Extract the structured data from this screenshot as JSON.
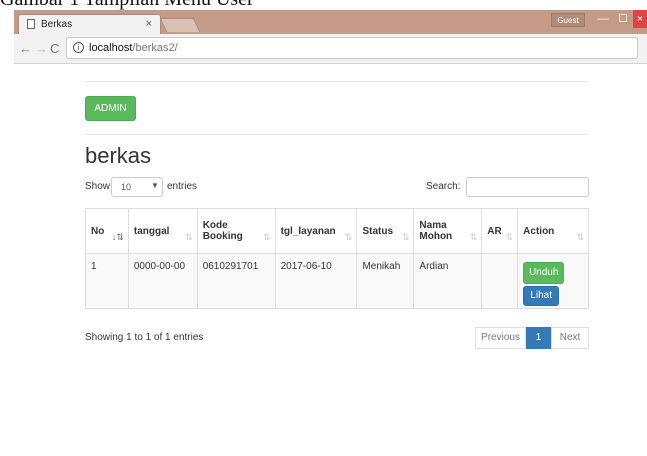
{
  "caption": "Gambar 1 Tampilan Menu User",
  "browser": {
    "tab_title": "Berkas",
    "tab_close": "×",
    "guest_label": "Guest",
    "url_host": "localhost",
    "url_path": "/berkas2/",
    "win_min": "—",
    "win_max": "☐",
    "win_close": "×",
    "back": "←",
    "forward": "→",
    "reload": "C",
    "menu": "⋮"
  },
  "page": {
    "admin_button": "ADMIN",
    "heading": "berkas",
    "show_label": "Show",
    "entries_value": "10",
    "entries_label": "entries",
    "search_label": "Search:",
    "search_value": "",
    "info_text": "Showing 1 to 1 of 1 entries",
    "pagination": {
      "previous": "Previous",
      "current": "1",
      "next": "Next"
    }
  },
  "table": {
    "columns": [
      {
        "label": "No",
        "sort": "↓⇅"
      },
      {
        "label": "tanggal",
        "sort": "⇅"
      },
      {
        "label": "Kode Booking",
        "sort": "⇅"
      },
      {
        "label": "tgl_layanan",
        "sort": "⇅"
      },
      {
        "label": "Status",
        "sort": "⇅"
      },
      {
        "label": "Nama Mohon",
        "sort": "⇅"
      },
      {
        "label": "AR",
        "sort": "⇅"
      },
      {
        "label": "Action",
        "sort": "⇅"
      }
    ],
    "rows": [
      {
        "no": "1",
        "tanggal": "0000-00-00",
        "kode_booking": "0610291701",
        "tgl_layanan": "2017-06-10",
        "status": "Menikah",
        "nama_mohon": "Ardian",
        "ar": "",
        "actions": {
          "unduh": "Unduh",
          "lihat": "Lihat"
        }
      }
    ]
  },
  "colors": {
    "titlebar": "#c49b87",
    "success": "#5cb85c",
    "primary": "#337ab7",
    "close": "#e04343"
  },
  "icons": [
    "doc-icon",
    "info-icon",
    "sort-icon",
    "back-icon",
    "forward-icon",
    "reload-icon",
    "menu-icon"
  ]
}
